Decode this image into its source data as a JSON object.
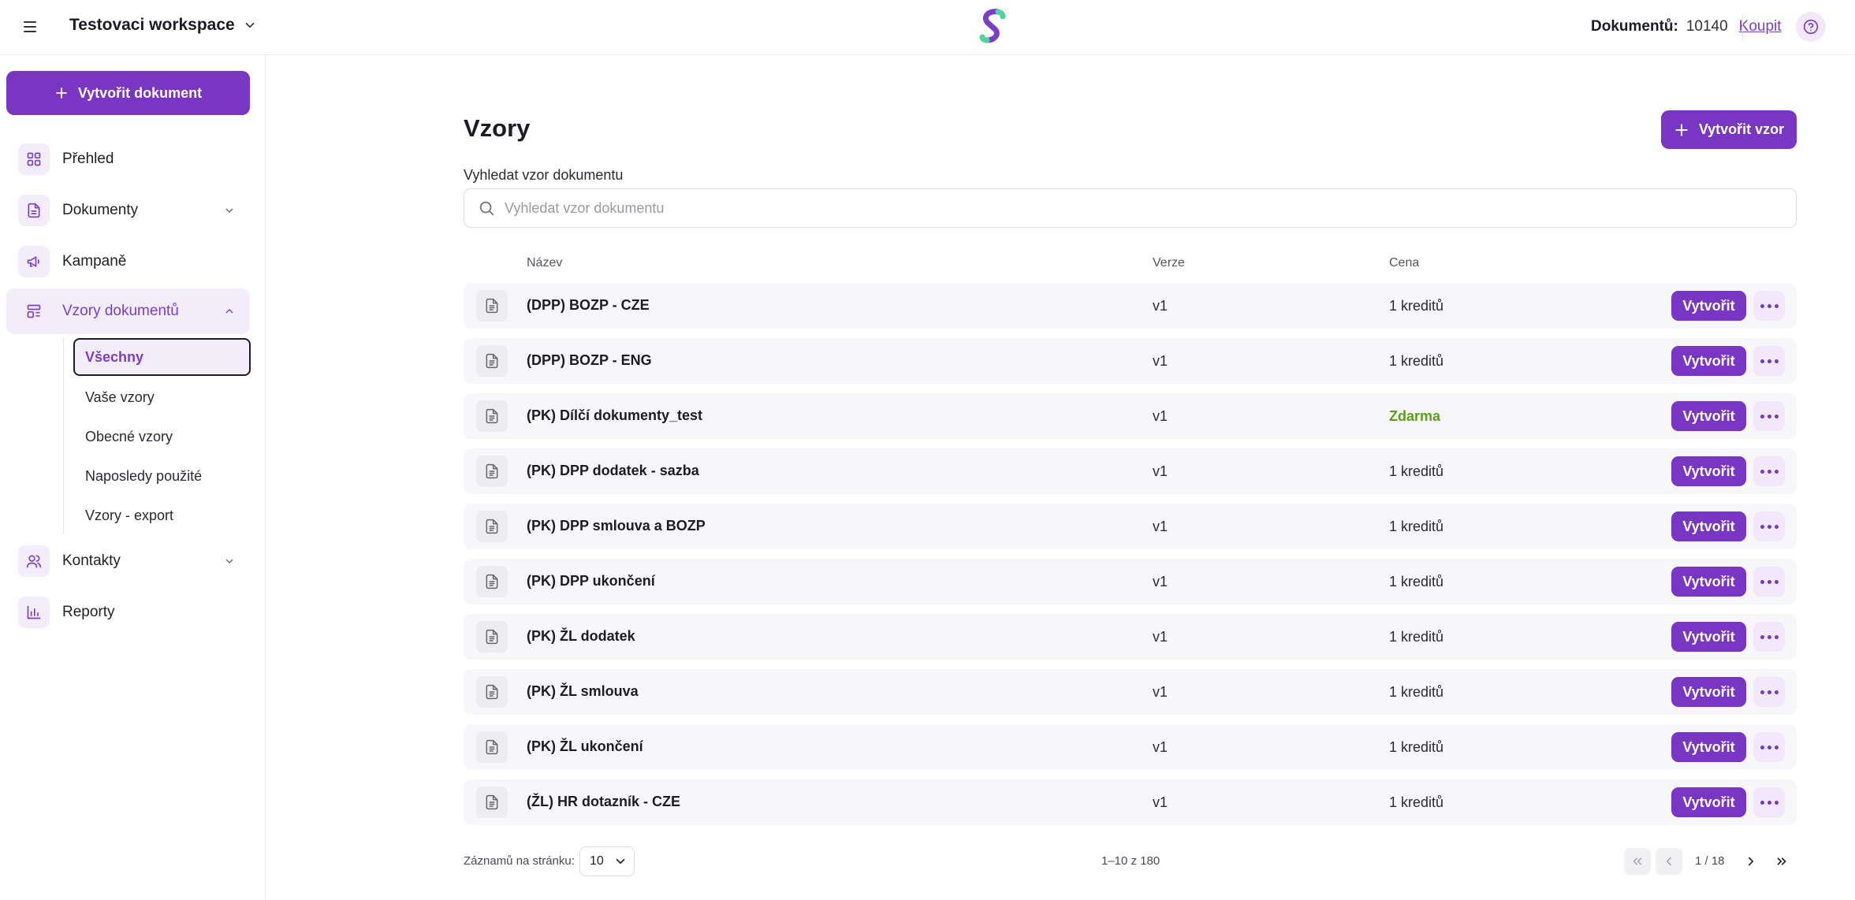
{
  "header": {
    "workspace_name": "Testovaci workspace",
    "documents_label": "Dokumentů:",
    "documents_count": "10140",
    "buy_label": "Koupit"
  },
  "sidebar": {
    "create_button": "Vytvořit dokument",
    "items": [
      {
        "label": "Přehled",
        "icon": "grid-icon"
      },
      {
        "label": "Dokumenty",
        "icon": "file-icon"
      },
      {
        "label": "Kampaně",
        "icon": "megaphone-icon"
      },
      {
        "label": "Vzory dokumentů",
        "icon": "template-icon"
      },
      {
        "label": "Kontakty",
        "icon": "users-icon"
      },
      {
        "label": "Reporty",
        "icon": "bar-chart-icon"
      }
    ],
    "sub_items": [
      "Všechny",
      "Vaše vzory",
      "Obecné vzory",
      "Naposledy použité",
      "Vzory - export"
    ]
  },
  "main": {
    "title": "Vzory",
    "create_template_button": "Vytvořit vzor",
    "search_label": "Vyhledat vzor dokumentu",
    "search_placeholder": "Vyhledat vzor dokumentu",
    "columns": {
      "name": "Název",
      "version": "Verze",
      "price": "Cena"
    },
    "create_row_label": "Vytvořit",
    "rows": [
      {
        "name": "(DPP) BOZP - CZE",
        "version": "v1",
        "price": "1 kreditů",
        "free": false
      },
      {
        "name": "(DPP) BOZP - ENG",
        "version": "v1",
        "price": "1 kreditů",
        "free": false
      },
      {
        "name": "(PK) Dílčí dokumenty_test",
        "version": "v1",
        "price": "Zdarma",
        "free": true
      },
      {
        "name": "(PK) DPP dodatek - sazba",
        "version": "v1",
        "price": "1 kreditů",
        "free": false
      },
      {
        "name": "(PK) DPP smlouva a BOZP",
        "version": "v1",
        "price": "1 kreditů",
        "free": false
      },
      {
        "name": "(PK) DPP ukončení",
        "version": "v1",
        "price": "1 kreditů",
        "free": false
      },
      {
        "name": "(PK) ŽL dodatek",
        "version": "v1",
        "price": "1 kreditů",
        "free": false
      },
      {
        "name": "(PK) ŽL smlouva",
        "version": "v1",
        "price": "1 kreditů",
        "free": false
      },
      {
        "name": "(PK) ŽL ukončení",
        "version": "v1",
        "price": "1 kreditů",
        "free": false
      },
      {
        "name": "(ŽL) HR dotazník - CZE",
        "version": "v1",
        "price": "1 kreditů",
        "free": false
      }
    ]
  },
  "pagination": {
    "per_page_label": "Záznamů na stránku:",
    "per_page_value": "10",
    "range_text": "1–10 z 180",
    "page_indicator": "1 / 18"
  },
  "colors": {
    "accent": "#7836c3",
    "accent_light": "#f3ecfb",
    "free_green": "#5a9e1c"
  }
}
